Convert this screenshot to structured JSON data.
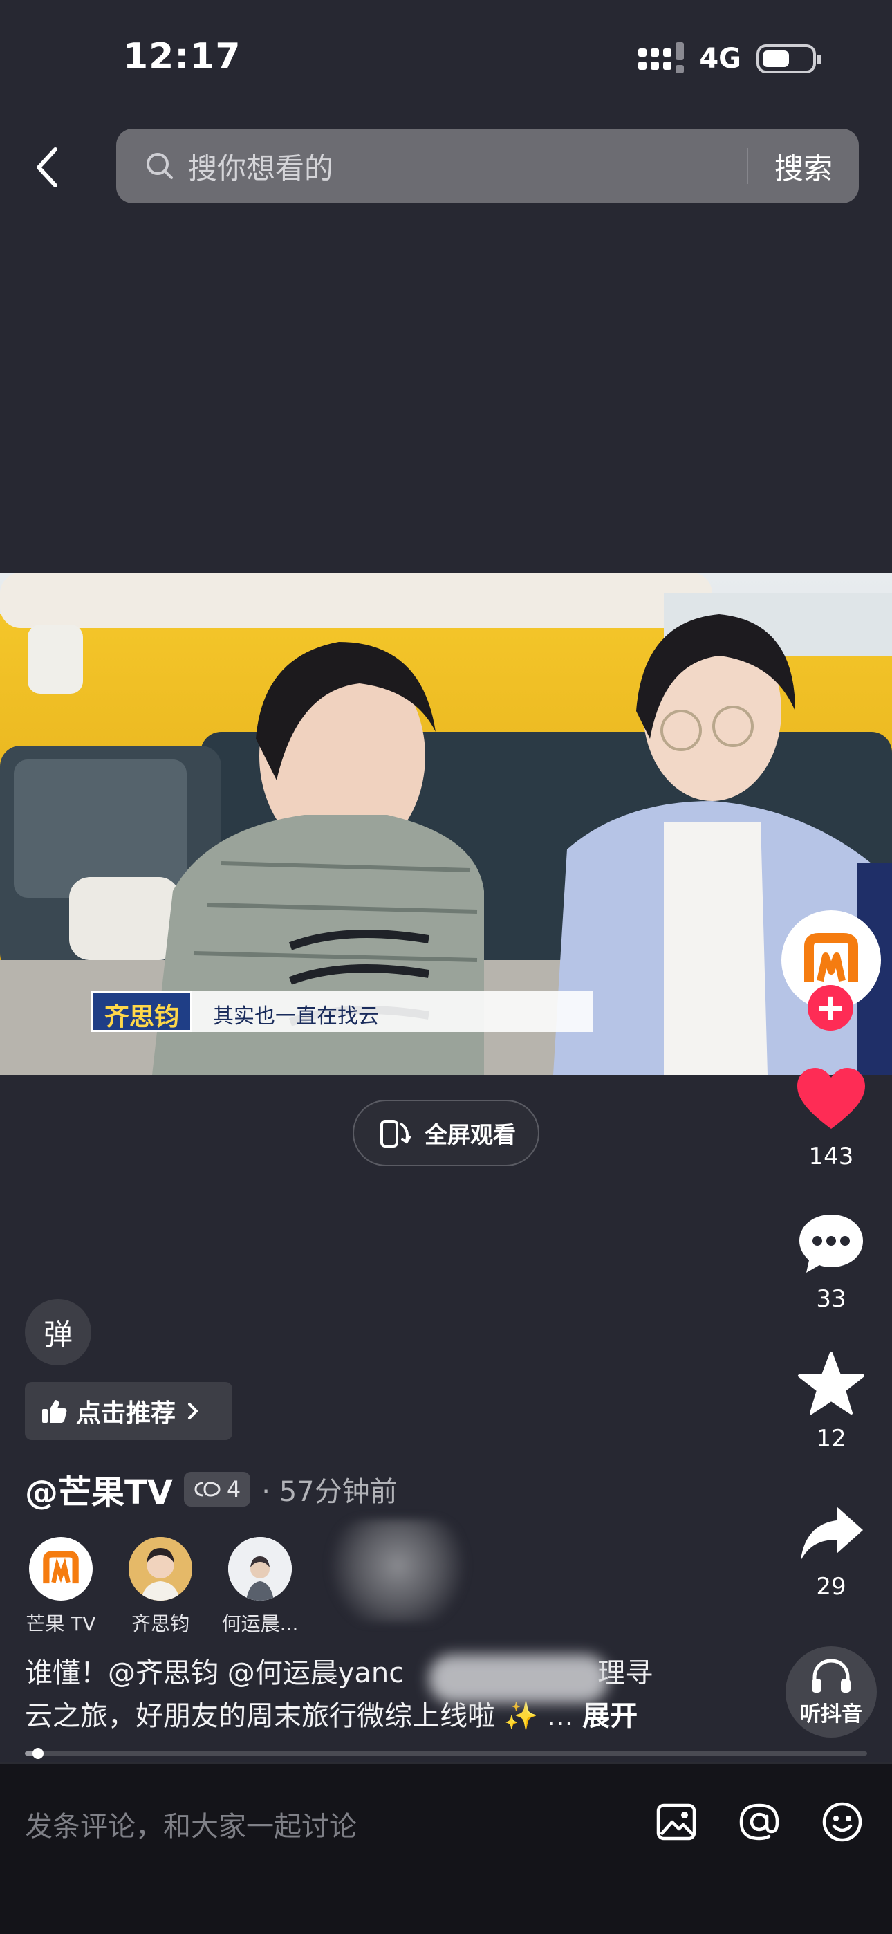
{
  "status_bar": {
    "time": "12:17",
    "network": "4G"
  },
  "search": {
    "placeholder": "搜你想看的",
    "button": "搜索"
  },
  "video": {
    "subtitle_name": "齐思钧",
    "subtitle_text": "其实也一直在找云",
    "fullscreen_label": "全屏观看"
  },
  "rail": {
    "likes": "143",
    "comments": "33",
    "favorites": "12",
    "shares": "29",
    "listen_label": "听抖音"
  },
  "danmu_label": "弹",
  "recommend_label": "点击推荐",
  "author": {
    "name": "@芒果TV",
    "collab_tag": "4",
    "time": "· 57分钟前"
  },
  "people": [
    {
      "name": "芒果 TV"
    },
    {
      "name": "齐思钧"
    },
    {
      "name": "何运晨..."
    }
  ],
  "description": {
    "line1": "谁懂！@齐思钧 @何运晨yanc",
    "line1_tail": "理寻",
    "line2": "云之旅，好朋友的周末旅行微综上线啦 ✨ ...",
    "expand": "展开"
  },
  "progress": 0.016,
  "comment_bar": {
    "placeholder": "发条评论，和大家一起讨论"
  },
  "colors": {
    "background": "#272832",
    "like": "#fe2c55",
    "brand_orange": "#f57c10"
  }
}
